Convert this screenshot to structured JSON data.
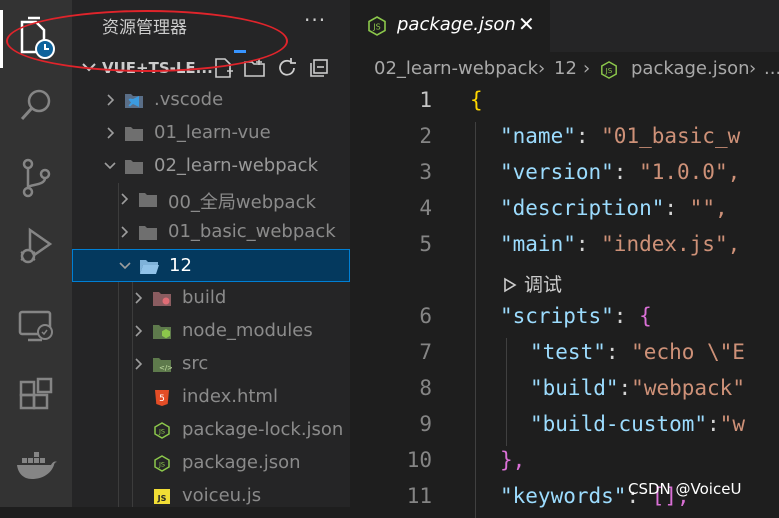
{
  "activity_bar": {
    "items": [
      {
        "name": "explorer-icon"
      },
      {
        "name": "search-icon"
      },
      {
        "name": "source-control-icon"
      },
      {
        "name": "run-debug-icon"
      },
      {
        "name": "remote-explorer-icon"
      },
      {
        "name": "extensions-icon"
      },
      {
        "name": "docker-icon"
      }
    ]
  },
  "sidebar": {
    "title": "资源管理器",
    "more": "···",
    "workspace": "VUE+TS-LE...",
    "actions": [
      "new-file-icon",
      "new-folder-icon",
      "refresh-icon",
      "collapse-all-icon"
    ],
    "tree": [
      {
        "label": ".vscode",
        "type": "folder-vscode",
        "depth": 0,
        "expanded": false
      },
      {
        "label": "01_learn-vue",
        "type": "folder",
        "depth": 0,
        "expanded": false
      },
      {
        "label": "02_learn-webpack",
        "type": "folder",
        "depth": 0,
        "expanded": true
      },
      {
        "label": "00_全局webpack",
        "type": "folder",
        "depth": 1,
        "expanded": false
      },
      {
        "label": "01_basic_webpack",
        "type": "folder",
        "depth": 1,
        "expanded": false
      },
      {
        "label": "12",
        "type": "folder-open",
        "depth": 1,
        "expanded": true,
        "selected": true
      },
      {
        "label": "build",
        "type": "folder-build",
        "depth": 2,
        "expanded": false
      },
      {
        "label": "node_modules",
        "type": "folder-node",
        "depth": 2,
        "expanded": false
      },
      {
        "label": "src",
        "type": "folder-src",
        "depth": 2,
        "expanded": false
      },
      {
        "label": "index.html",
        "type": "html",
        "depth": 2
      },
      {
        "label": "package-lock.json",
        "type": "node",
        "depth": 2
      },
      {
        "label": "package.json",
        "type": "node",
        "depth": 2
      },
      {
        "label": "voiceu.js",
        "type": "js",
        "depth": 2
      }
    ]
  },
  "editor": {
    "tab": {
      "label": "package.json",
      "close": "✕"
    },
    "breadcrumb": [
      "02_learn-webpack",
      "12",
      "package.json",
      "..."
    ],
    "code_lens": "调试",
    "lines": [
      {
        "num": "1",
        "text": "{"
      },
      {
        "num": "2",
        "key": "\"name\"",
        "value": "\"01_basic_w"
      },
      {
        "num": "3",
        "key": "\"version\"",
        "value": "\"1.0.0\","
      },
      {
        "num": "4",
        "key": "\"description\"",
        "value": "\"\","
      },
      {
        "num": "5",
        "key": "\"main\"",
        "value": "\"index.js\","
      },
      {
        "num": "6",
        "key": "\"scripts\"",
        "value": "{"
      },
      {
        "num": "7",
        "key": "\"test\"",
        "value": "\"echo \\\"E"
      },
      {
        "num": "8",
        "key": "\"build\"",
        "value": "\"webpack\""
      },
      {
        "num": "9",
        "key": "\"build-custom\"",
        "value": "\"w"
      },
      {
        "num": "10",
        "text": "},"
      },
      {
        "num": "11",
        "key": "\"keywords\"",
        "value": "[],"
      }
    ]
  },
  "watermark": "CSDN @VoiceU",
  "colors": {
    "accent": "#007fd4",
    "annotation": "#e0242b",
    "json_key": "#9cdcfe",
    "json_string": "#ce9178",
    "node_green": "#8cc84b"
  }
}
